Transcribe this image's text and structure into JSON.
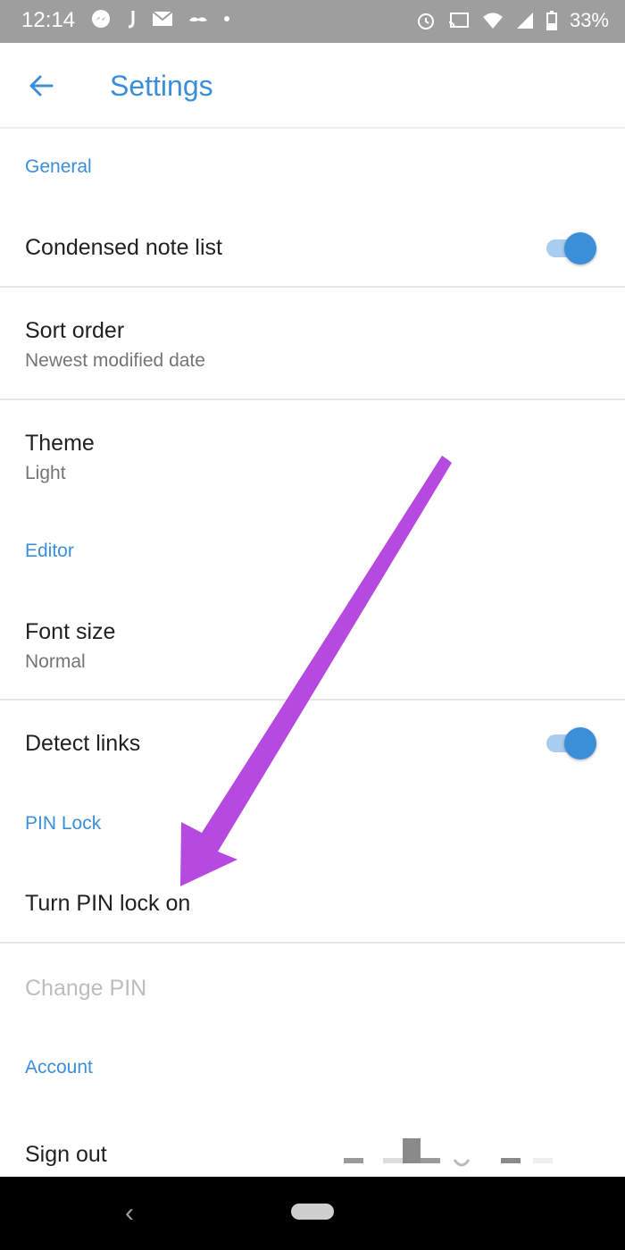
{
  "status_bar": {
    "time": "12:14",
    "battery": "33%"
  },
  "header": {
    "title": "Settings"
  },
  "sections": {
    "general": "General",
    "editor": "Editor",
    "pin_lock": "PIN Lock",
    "account": "Account"
  },
  "items": {
    "condensed_note_list": {
      "title": "Condensed note list",
      "enabled": true
    },
    "sort_order": {
      "title": "Sort order",
      "value": "Newest modified date"
    },
    "theme": {
      "title": "Theme",
      "value": "Light"
    },
    "font_size": {
      "title": "Font size",
      "value": "Normal"
    },
    "detect_links": {
      "title": "Detect links",
      "enabled": true
    },
    "turn_pin_lock_on": {
      "title": "Turn PIN lock on"
    },
    "change_pin": {
      "title": "Change PIN"
    },
    "sign_out": {
      "title": "Sign out"
    }
  },
  "colors": {
    "accent": "#3b8fd9",
    "annotation_arrow": "#b64ae0",
    "status_bar": "#9e9e9e"
  }
}
